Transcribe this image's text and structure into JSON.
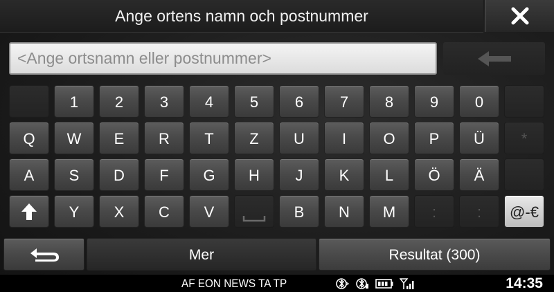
{
  "header": {
    "title": "Ange ortens namn och postnummer",
    "close_icon": "close-x-icon"
  },
  "search": {
    "placeholder": "<Ange ortsnamn eller postnummer>",
    "value": "",
    "backspace_icon": "arrow-left-icon"
  },
  "keyboard": {
    "rows": [
      [
        {
          "label": "",
          "state": "disabled"
        },
        {
          "label": "1"
        },
        {
          "label": "2"
        },
        {
          "label": "3"
        },
        {
          "label": "4"
        },
        {
          "label": "5"
        },
        {
          "label": "6"
        },
        {
          "label": "7"
        },
        {
          "label": "8"
        },
        {
          "label": "9"
        },
        {
          "label": "0"
        },
        {
          "label": "",
          "state": "disabled"
        }
      ],
      [
        {
          "label": "Q"
        },
        {
          "label": "W"
        },
        {
          "label": "E"
        },
        {
          "label": "R"
        },
        {
          "label": "T"
        },
        {
          "label": "Z"
        },
        {
          "label": "U"
        },
        {
          "label": "I"
        },
        {
          "label": "O"
        },
        {
          "label": "P"
        },
        {
          "label": "Ü"
        },
        {
          "label": "*",
          "state": "disabled"
        }
      ],
      [
        {
          "label": "A"
        },
        {
          "label": "S"
        },
        {
          "label": "D"
        },
        {
          "label": "F"
        },
        {
          "label": "G"
        },
        {
          "label": "H"
        },
        {
          "label": "J"
        },
        {
          "label": "K"
        },
        {
          "label": "L"
        },
        {
          "label": "Ö"
        },
        {
          "label": "Ä"
        },
        {
          "label": "",
          "state": "disabled"
        }
      ],
      [
        {
          "label": "",
          "icon": "shift-arrow-icon"
        },
        {
          "label": "Y"
        },
        {
          "label": "X"
        },
        {
          "label": "C"
        },
        {
          "label": "V"
        },
        {
          "label": "",
          "icon": "space-icon",
          "state": "disabled"
        },
        {
          "label": "B"
        },
        {
          "label": "N"
        },
        {
          "label": "M"
        },
        {
          "label": ":",
          "state": "disabled"
        },
        {
          "label": ":",
          "state": "disabled"
        },
        {
          "label": "@-€",
          "state": "light"
        }
      ]
    ]
  },
  "actions": {
    "back_icon": "return-arrow-icon",
    "more_label": "Mer",
    "results_label": "Resultat (300)"
  },
  "status": {
    "radio_flags": "AF EON NEWS TA TP",
    "icons": [
      "bluetooth-audio-icon",
      "bluetooth-phone-icon",
      "battery-icon",
      "signal-icon"
    ],
    "clock": "14:35"
  }
}
